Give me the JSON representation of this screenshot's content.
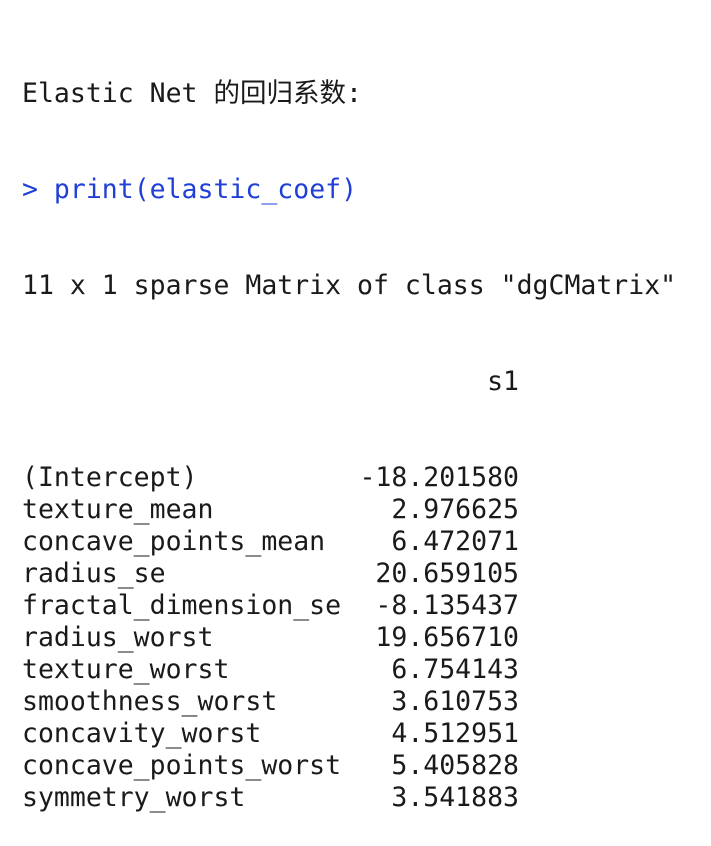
{
  "console": {
    "title_line": "Elastic Net 的回归系数:",
    "prompt": "> ",
    "command": "print(elastic_coef)",
    "matrix_info": "11 x 1 sparse Matrix of class \"dgCMatrix\"",
    "column_header": "s1",
    "rows": [
      {
        "name": "(Intercept)",
        "value": "-18.201580"
      },
      {
        "name": "texture_mean",
        "value": "2.976625"
      },
      {
        "name": "concave_points_mean",
        "value": "6.472071"
      },
      {
        "name": "radius_se",
        "value": "20.659105"
      },
      {
        "name": "fractal_dimension_se",
        "value": "-8.135437"
      },
      {
        "name": "radius_worst",
        "value": "19.656710"
      },
      {
        "name": "texture_worst",
        "value": "6.754143"
      },
      {
        "name": "smoothness_worst",
        "value": "3.610753"
      },
      {
        "name": "concavity_worst",
        "value": "4.512951"
      },
      {
        "name": "concave_points_worst",
        "value": "5.405828"
      },
      {
        "name": "symmetry_worst",
        "value": "3.541883"
      }
    ],
    "colors": {
      "command": "#1f3fd6",
      "output": "#1a1a1a",
      "background": "#ffffff"
    }
  }
}
